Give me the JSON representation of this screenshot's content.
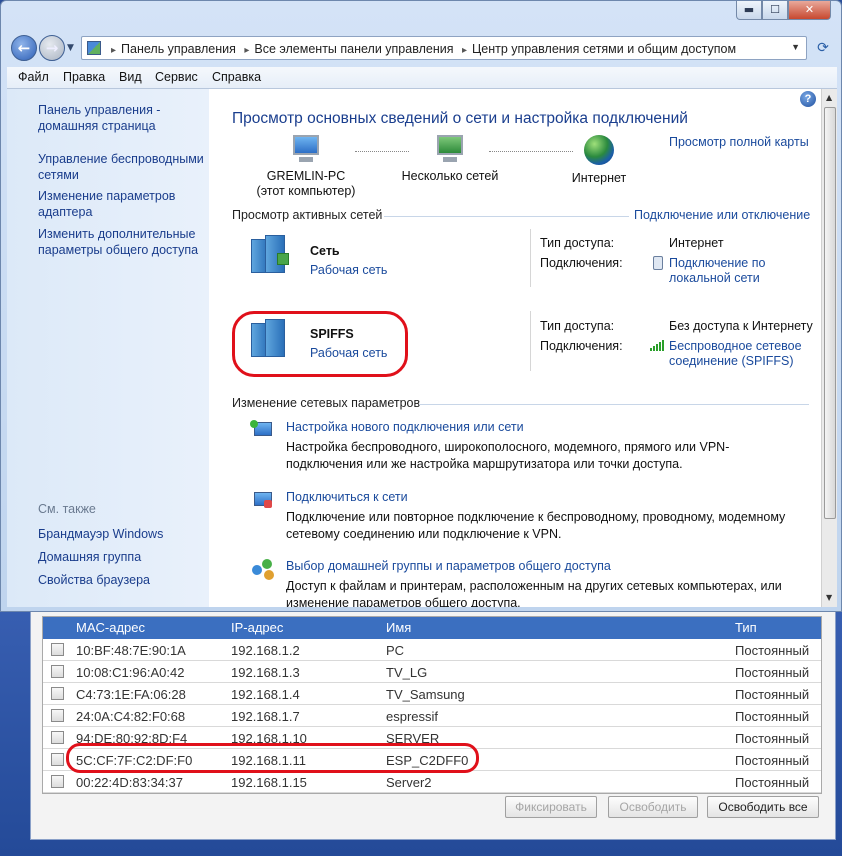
{
  "window": {
    "caption_buttons": {
      "min": "▬",
      "max": "☐",
      "close": "✕"
    },
    "breadcrumbs": [
      "Панель управления",
      "Все элементы панели управления",
      "Центр управления сетями и общим доступом"
    ],
    "breadcrumb_sep": "▸"
  },
  "menu": [
    "Файл",
    "Правка",
    "Вид",
    "Сервис",
    "Справка"
  ],
  "sidebar": {
    "links": [
      "Панель управления - домашняя страница",
      "Управление беспроводными сетями",
      "Изменение параметров адаптера",
      "Изменить дополнительные параметры общего доступа"
    ],
    "see_also_title": "См. также",
    "see_also": [
      "Брандмауэр Windows",
      "Домашняя группа",
      "Свойства браузера"
    ]
  },
  "main": {
    "title": "Просмотр основных сведений о сети и настройка подключений",
    "full_map_link": "Просмотр полной карты",
    "map": {
      "computer": "GREMLIN-PC",
      "computer_sub": "(этот компьютер)",
      "networks": "Несколько сетей",
      "internet": "Интернет"
    },
    "active_networks_header": "Просмотр активных сетей",
    "connect_disconnect_link": "Подключение или отключение",
    "networks": [
      {
        "name": "Сеть",
        "type": "Рабочая сеть",
        "access_label": "Тип доступа:",
        "access_value": "Интернет",
        "conn_label": "Подключения:",
        "conn_value": "Подключение по локальной сети"
      },
      {
        "name": "SPIFFS",
        "type": "Рабочая сеть",
        "access_label": "Тип доступа:",
        "access_value": "Без доступа к Интернету",
        "conn_label": "Подключения:",
        "conn_value": "Беспроводное сетевое соединение (SPIFFS)"
      }
    ],
    "change_settings_header": "Изменение сетевых параметров",
    "tasks": [
      {
        "link": "Настройка нового подключения или сети",
        "desc": "Настройка беспроводного, широкополосного, модемного, прямого или VPN-подключения или же настройка маршрутизатора или точки доступа."
      },
      {
        "link": "Подключиться к сети",
        "desc": "Подключение или повторное подключение к беспроводному, проводному, модемному сетевому соединению или подключение к VPN."
      },
      {
        "link": "Выбор домашней группы и параметров общего доступа",
        "desc": "Доступ к файлам и принтерам, расположенным на других сетевых компьютерах, или изменение параметров общего доступа."
      }
    ]
  },
  "dhcp": {
    "columns": [
      "MAC-адрес",
      "IP-адрес",
      "Имя",
      "Тип"
    ],
    "rows": [
      {
        "mac": "10:BF:48:7E:90:1A",
        "ip": "192.168.1.2",
        "name": "PC",
        "type": "Постоянный"
      },
      {
        "mac": "10:08:C1:96:A0:42",
        "ip": "192.168.1.3",
        "name": "TV_LG",
        "type": "Постоянный"
      },
      {
        "mac": "C4:73:1E:FA:06:28",
        "ip": "192.168.1.4",
        "name": "TV_Samsung",
        "type": "Постоянный"
      },
      {
        "mac": "24:0A:C4:82:F0:68",
        "ip": "192.168.1.7",
        "name": "espressif",
        "type": "Постоянный"
      },
      {
        "mac": "94:DE:80:92:8D:F4",
        "ip": "192.168.1.10",
        "name": "SERVER",
        "type": "Постоянный"
      },
      {
        "mac": "5C:CF:7F:C2:DF:F0",
        "ip": "192.168.1.11",
        "name": "ESP_C2DFF0",
        "type": "Постоянный"
      },
      {
        "mac": "00:22:4D:83:34:37",
        "ip": "192.168.1.15",
        "name": "Server2",
        "type": "Постоянный"
      }
    ],
    "buttons": {
      "fix": "Фиксировать",
      "release": "Освободить",
      "release_all": "Освободить все"
    }
  }
}
